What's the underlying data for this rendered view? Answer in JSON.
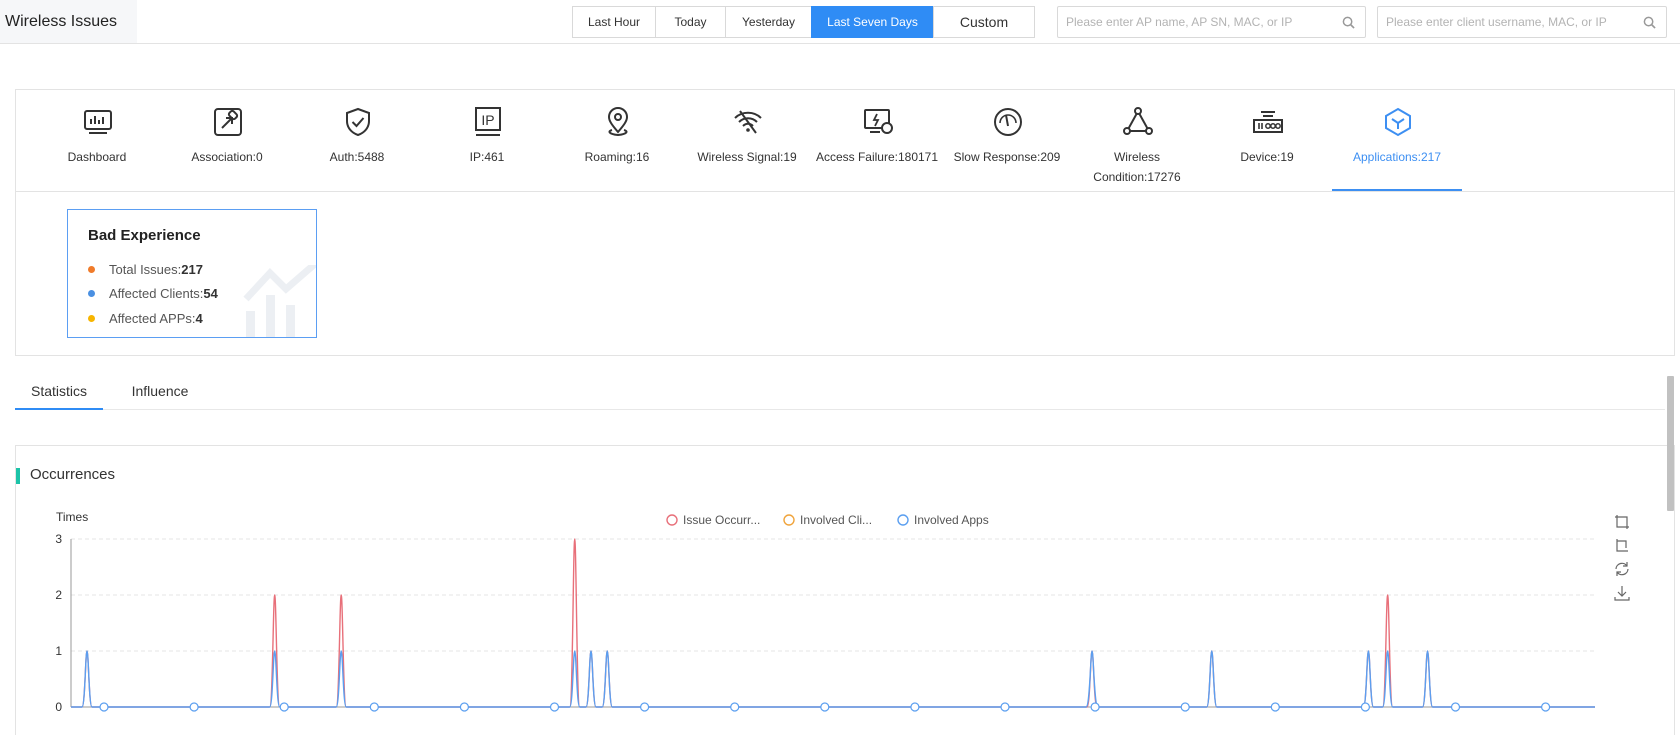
{
  "header": {
    "title": "Wireless Issues",
    "time_ranges": [
      {
        "label": "Last Hour",
        "active": false
      },
      {
        "label": "Today",
        "active": false
      },
      {
        "label": "Yesterday",
        "active": false
      },
      {
        "label": "Last Seven Days",
        "active": true
      },
      {
        "label": "Custom",
        "active": false
      }
    ],
    "ap_search_placeholder": "Please enter AP name, AP SN, MAC, or IP",
    "client_search_placeholder": "Please enter client username, MAC, or IP"
  },
  "categories": [
    {
      "label": "Dashboard",
      "icon": "dashboard-icon",
      "active": false
    },
    {
      "label": "Association:0",
      "icon": "association-icon",
      "active": false
    },
    {
      "label": "Auth:5488",
      "icon": "auth-shield-icon",
      "active": false
    },
    {
      "label": "IP:461",
      "icon": "ip-icon",
      "active": false
    },
    {
      "label": "Roaming:16",
      "icon": "location-pin-icon",
      "active": false
    },
    {
      "label": "Wireless Signal:19",
      "icon": "wifi-off-icon",
      "active": false
    },
    {
      "label": "Access Failure:180171",
      "icon": "access-failure-icon",
      "active": false
    },
    {
      "label": "Slow Response:209",
      "icon": "gauge-icon",
      "active": false
    },
    {
      "label": "Wireless Condition:17276",
      "icon": "network-nodes-icon",
      "active": false
    },
    {
      "label": "Device:19",
      "icon": "device-icon",
      "active": false
    },
    {
      "label": "Applications:217",
      "icon": "applications-cube-icon",
      "active": true
    }
  ],
  "bad_experience": {
    "title": "Bad Experience",
    "rows": [
      {
        "label": "Total Issues:",
        "value": "217",
        "color": "#f07b2a"
      },
      {
        "label": "Affected Clients:",
        "value": "54",
        "color": "#4a90e2"
      },
      {
        "label": "Affected APPs:",
        "value": "4",
        "color": "#f7b500"
      }
    ]
  },
  "tabs": [
    {
      "label": "Statistics",
      "active": true
    },
    {
      "label": "Influence",
      "active": false
    }
  ],
  "occurrences": {
    "title": "Occurrences",
    "toolbox_icons": [
      "zoom-select-icon",
      "zoom-reset-icon",
      "restore-icon",
      "download-icon"
    ]
  },
  "chart_data": {
    "type": "line",
    "ylabel": "Times",
    "ylim": [
      0,
      3
    ],
    "yticks": [
      0,
      1,
      2,
      3
    ],
    "legend_position": "top-center",
    "grid": true,
    "series": [
      {
        "name": "Issue Occurr...",
        "color": "#e8707a",
        "peaks": [
          [
            0.0,
            1
          ],
          [
            0.127,
            2
          ],
          [
            0.172,
            2
          ],
          [
            0.33,
            3
          ],
          [
            0.341,
            1
          ],
          [
            0.352,
            1
          ],
          [
            0.68,
            1
          ],
          [
            0.761,
            1
          ],
          [
            0.867,
            1
          ],
          [
            0.88,
            2
          ],
          [
            0.907,
            1
          ]
        ]
      },
      {
        "name": "Involved Cli...",
        "color": "#f0a43c",
        "peaks": [
          [
            0.0,
            1
          ],
          [
            0.127,
            1
          ],
          [
            0.172,
            1
          ],
          [
            0.33,
            1
          ],
          [
            0.341,
            1
          ],
          [
            0.352,
            1
          ],
          [
            0.68,
            1
          ],
          [
            0.761,
            1
          ],
          [
            0.867,
            1
          ],
          [
            0.88,
            1
          ],
          [
            0.907,
            1
          ]
        ]
      },
      {
        "name": "Involved Apps",
        "color": "#5b9ff0",
        "peaks": [
          [
            0.0,
            1
          ],
          [
            0.127,
            1
          ],
          [
            0.172,
            1
          ],
          [
            0.33,
            1
          ],
          [
            0.341,
            1
          ],
          [
            0.352,
            1
          ],
          [
            0.68,
            1
          ],
          [
            0.761,
            1
          ],
          [
            0.867,
            1
          ],
          [
            0.88,
            1
          ],
          [
            0.907,
            1
          ]
        ]
      }
    ]
  }
}
